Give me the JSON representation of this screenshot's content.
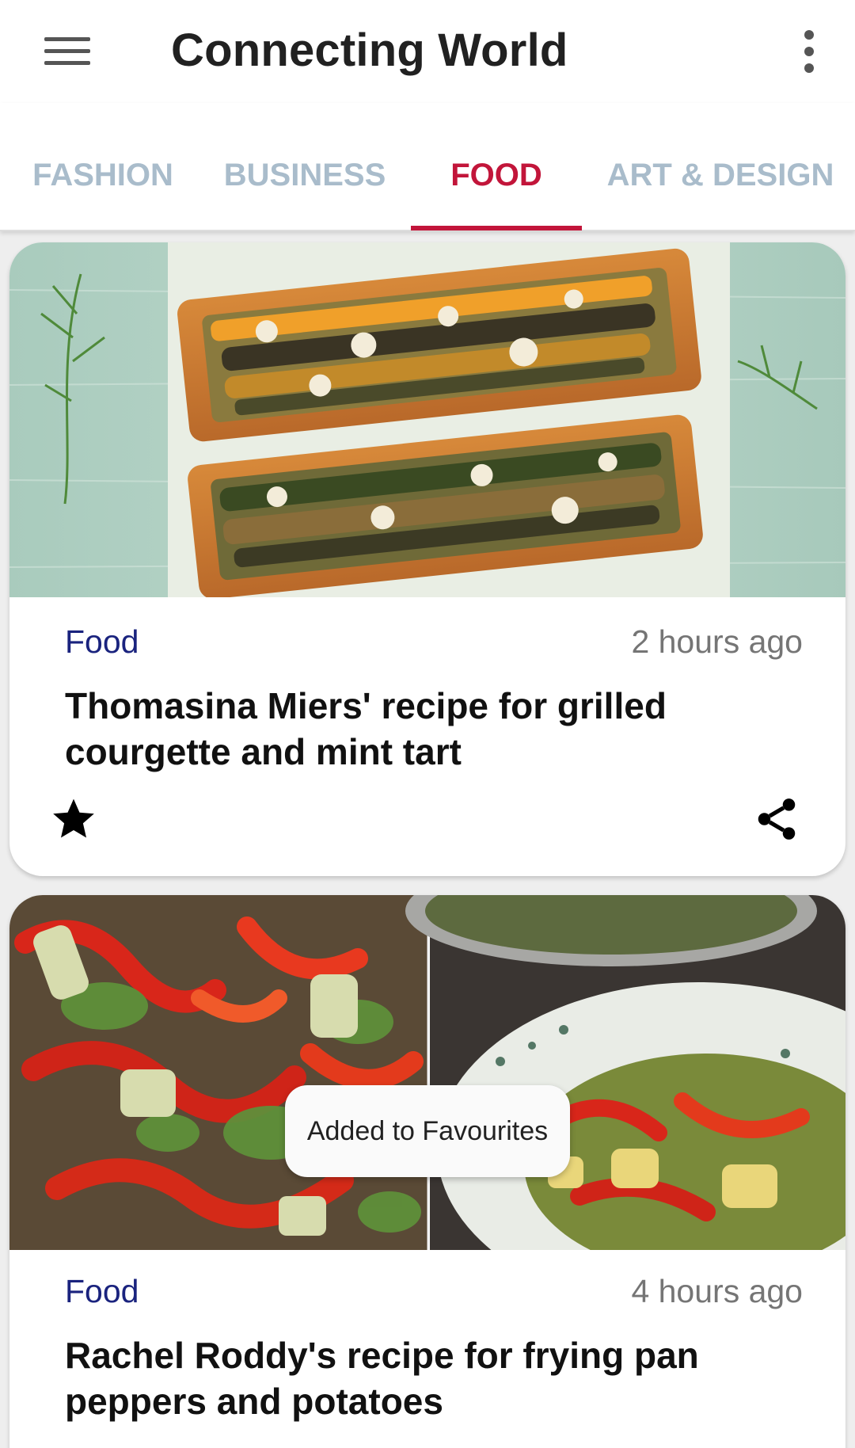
{
  "app_bar": {
    "title": "Connecting World",
    "menu_icon": "hamburger-menu-icon",
    "overflow_icon": "more-vert-icon"
  },
  "tabs": [
    {
      "label": "FASHION",
      "active": false
    },
    {
      "label": "BUSINESS",
      "active": false
    },
    {
      "label": "FOOD",
      "active": true
    },
    {
      "label": "ART & DESIGN",
      "active": false
    }
  ],
  "colors": {
    "accent": "#c2153a",
    "tab_inactive": "#a9bccb",
    "category": "#1a237e",
    "timestamp": "#757575"
  },
  "cards": [
    {
      "image": "grilled-courgette-tart-photo",
      "category": "Food",
      "time": "2 hours ago",
      "title": "Thomasina Miers' recipe for grilled courgette and mint tart",
      "favourite_icon": "star-filled-icon",
      "share_icon": "share-icon"
    },
    {
      "image": "frying-pan-peppers-potatoes-photo",
      "category": "Food",
      "time": "4 hours ago",
      "title": "Rachel Roddy's recipe for frying pan peppers and potatoes"
    }
  ],
  "toast": {
    "message": "Added to Favourites"
  }
}
